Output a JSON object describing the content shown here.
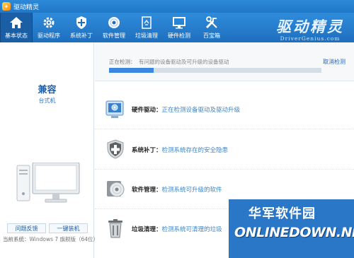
{
  "window": {
    "title": "驱动精灵"
  },
  "toolbar": {
    "items": [
      {
        "label": "基本状态",
        "icon": "home-icon",
        "active": true
      },
      {
        "label": "驱动程序",
        "icon": "gear-icon",
        "active": false
      },
      {
        "label": "系统补丁",
        "icon": "shield-icon",
        "active": false
      },
      {
        "label": "软件管理",
        "icon": "disc-icon",
        "active": false
      },
      {
        "label": "垃圾清理",
        "icon": "trash-icon",
        "active": false
      },
      {
        "label": "硬件检测",
        "icon": "monitor-icon",
        "active": false
      },
      {
        "label": "百宝箱",
        "icon": "tools-icon",
        "active": false
      }
    ],
    "brand_cn": "驱动精灵",
    "brand_en": "DriverGenius.com"
  },
  "left": {
    "pc_type": "兼容",
    "pc_sub": "台式机",
    "feedback_button": "问题反馈",
    "install_button": "一键装机",
    "sys_label": "当前系统：",
    "sys_value": "Windows 7 旗舰版（64位）"
  },
  "scan": {
    "label": "正在检测：",
    "text": "有问题的设备驱动及可升级的设备驱动",
    "cancel": "取消检测",
    "progress": 0.21
  },
  "checks": [
    {
      "title": "硬件驱动：",
      "desc": "正在检测设备驱动及驱动升级",
      "icon": "hardware-driver-icon"
    },
    {
      "title": "系统补丁：",
      "desc": "检测系统存在的安全隐患",
      "icon": "shield-plus-icon"
    },
    {
      "title": "软件管理：",
      "desc": "检测系统可升级的软件",
      "icon": "software-disc-icon"
    },
    {
      "title": "垃圾清理：",
      "desc": "检测系统可清理的垃圾",
      "icon": "trash-bin-icon"
    }
  ],
  "watermark": {
    "cn": "华军软件园",
    "en": "ONLINEDOWN.NET"
  },
  "colors": {
    "accent": "#2a7fd0",
    "link": "#1f66c4",
    "progress": "#3b86de"
  }
}
